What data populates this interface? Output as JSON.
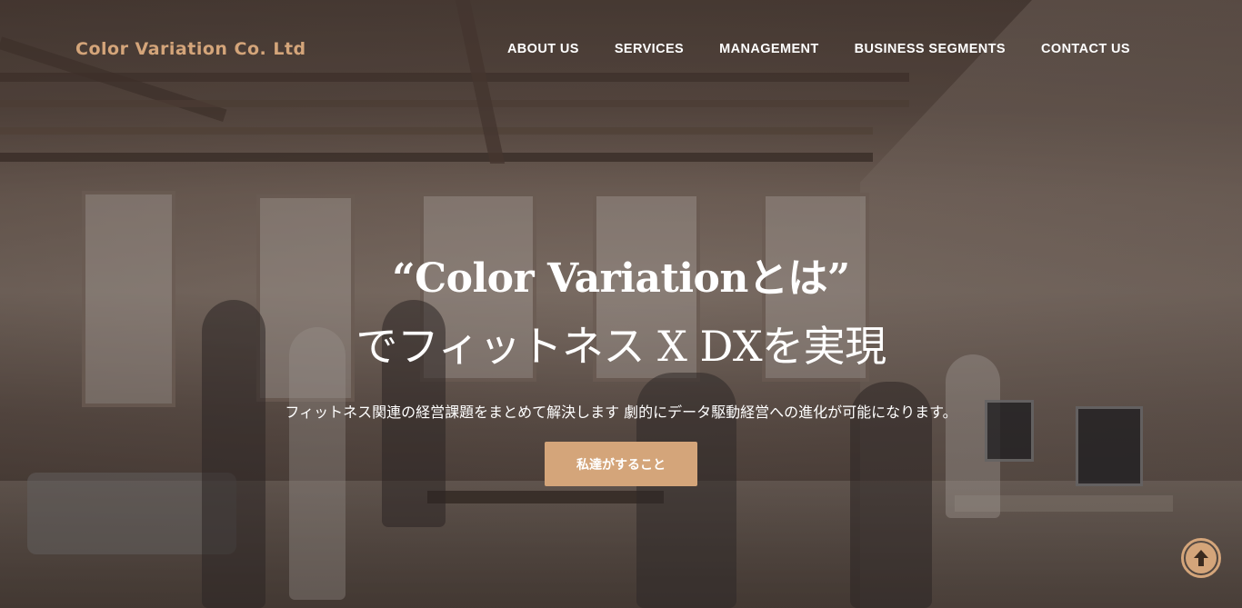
{
  "header": {
    "brand": "Color Variation Co. Ltd",
    "nav": [
      {
        "label": "ABOUT US"
      },
      {
        "label": "SERVICES"
      },
      {
        "label": "MANAGEMENT"
      },
      {
        "label": "BUSINESS SEGMENTS"
      },
      {
        "label": "CONTACT US"
      }
    ]
  },
  "hero": {
    "title_line1": "“Color Variationとは”",
    "title_line2": "でフィットネス X DXを実現",
    "subtitle": "フィットネス関連の経営課題をまとめて解決します 劇的にデータ駆動経営への進化が可能になります。",
    "cta_label": "私達がすること"
  },
  "icons": {
    "scroll_top": "arrow-up-icon"
  },
  "colors": {
    "accent": "#d4a57a",
    "text": "#ffffff"
  }
}
